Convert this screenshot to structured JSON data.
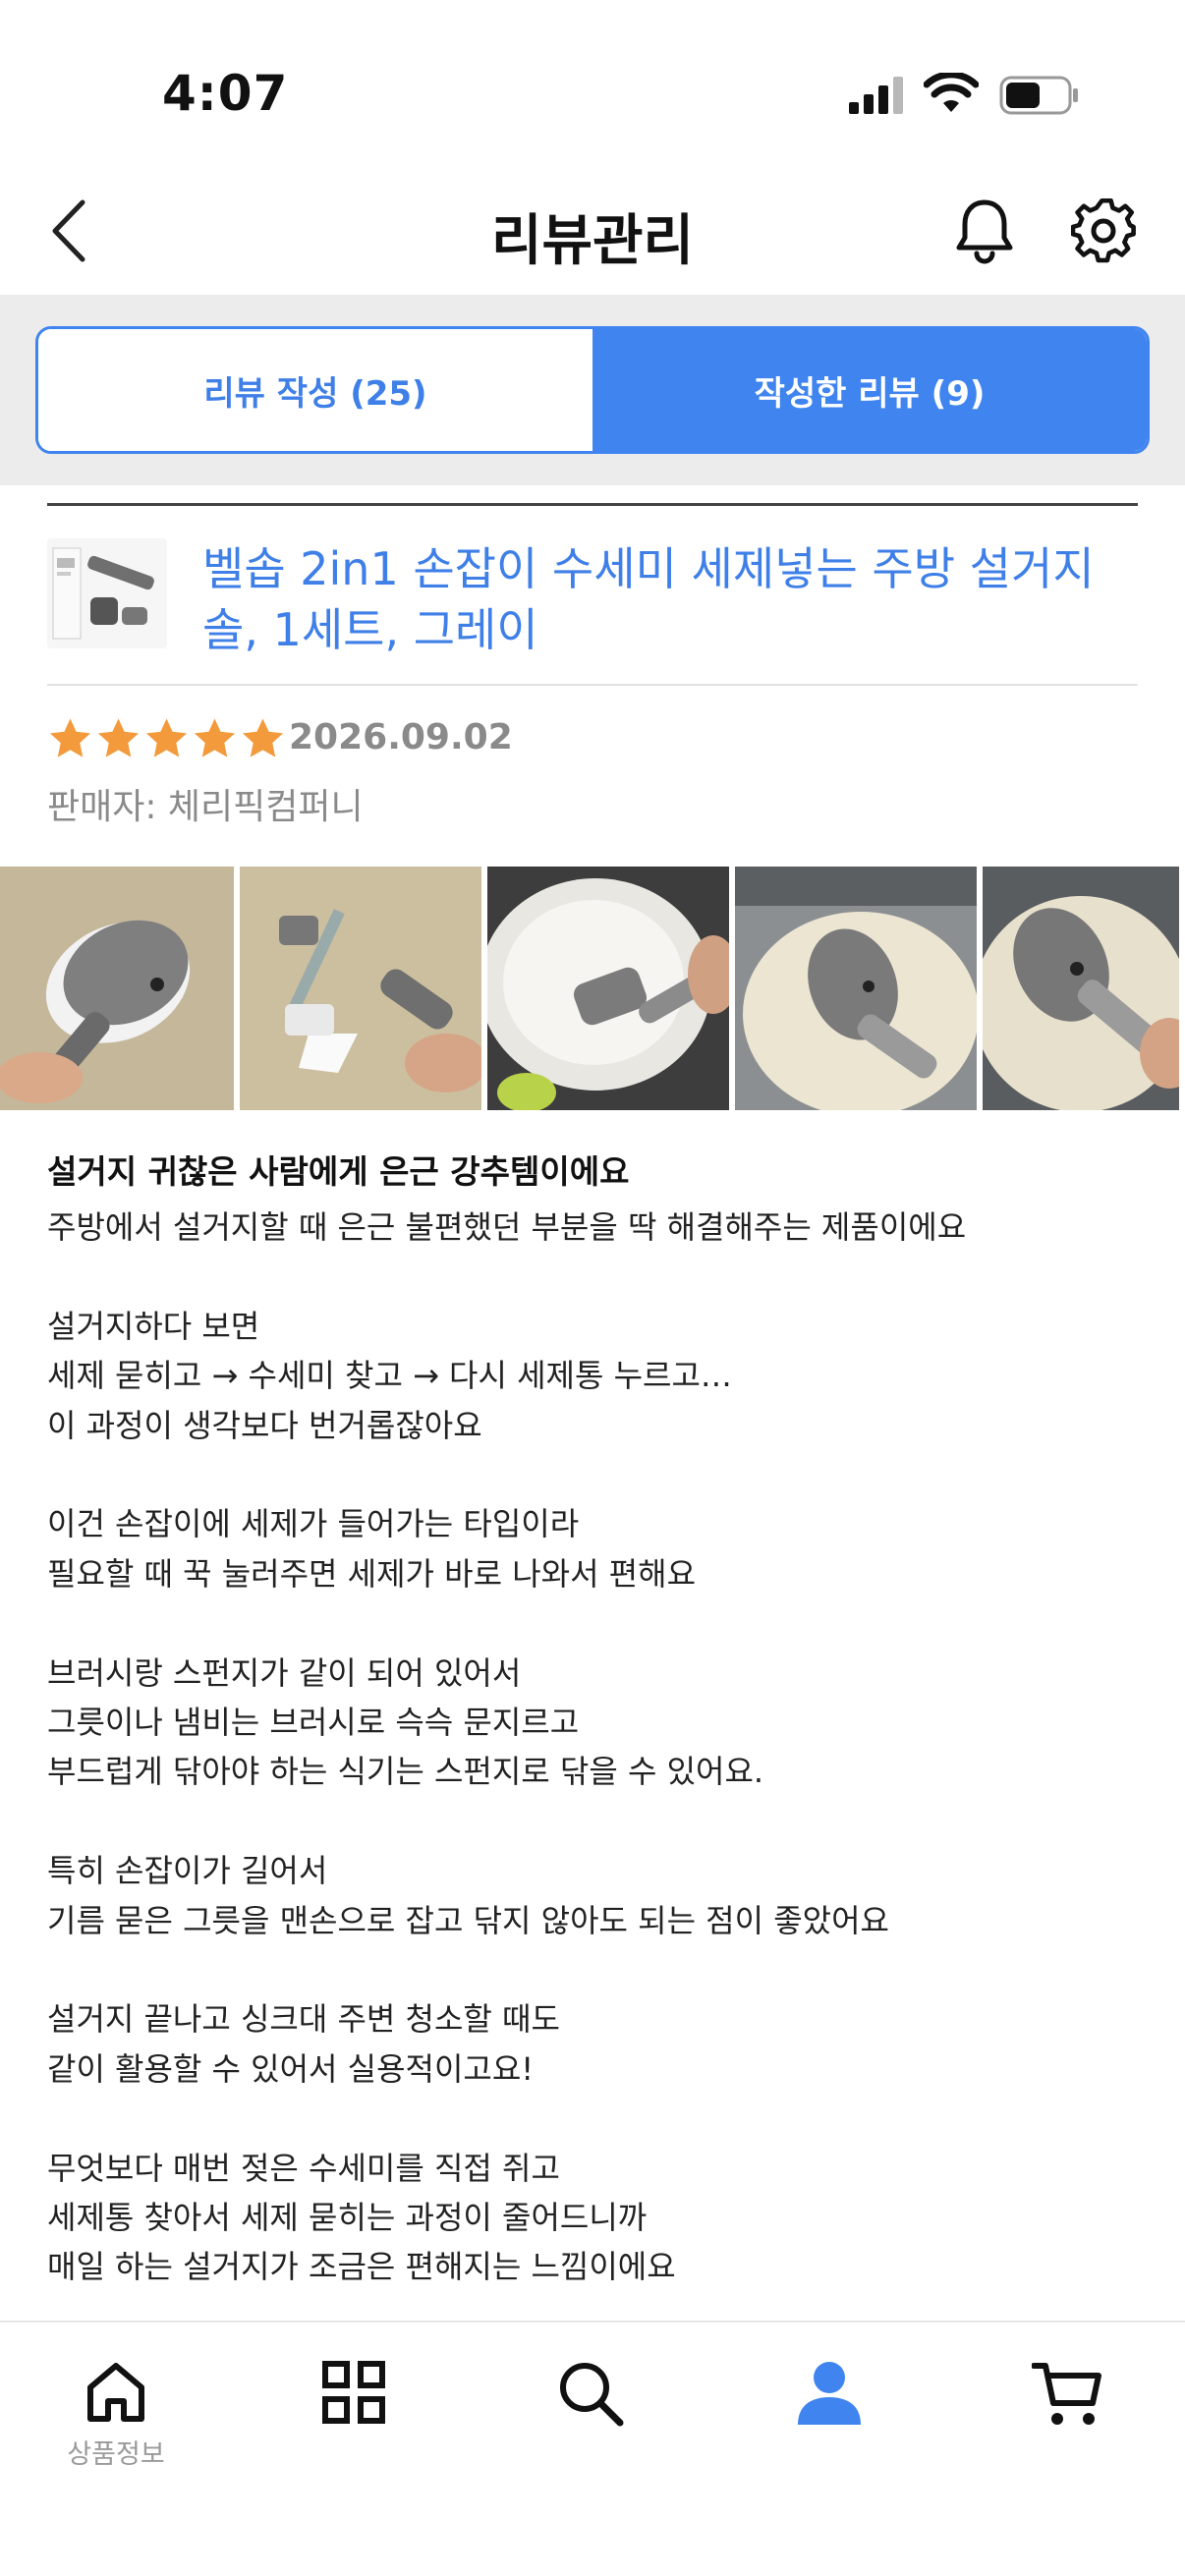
{
  "status_bar": {
    "time": "4:07"
  },
  "header": {
    "title": "리뷰관리"
  },
  "tabs": [
    {
      "label": "리뷰 작성 (25)",
      "active": false
    },
    {
      "label": "작성한 리뷰 (9)",
      "active": true
    }
  ],
  "product": {
    "name": "벨솝 2in1 손잡이 수세미 세제넣는 주방 설거지솔, 1세트, 그레이"
  },
  "review": {
    "rating": 5,
    "rating_max": 5,
    "date": "2026.09.02",
    "seller": "판매자: 체리픽컴퍼니",
    "title": "설거지 귀찮은 사람에게 은근 강추템이에요",
    "paragraphs": [
      [
        "주방에서 설거지할 때 은근 불편했던 부분을 딱 해결해주는 제품이에요"
      ],
      [
        "설거지하다 보면",
        "세제 묻히고 → 수세미 찾고 → 다시 세제통 누르고…",
        "이 과정이 생각보다 번거롭잖아요"
      ],
      [
        "이건 손잡이에 세제가 들어가는 타입이라",
        "필요할 때 꾹 눌러주면 세제가 바로 나와서 편해요"
      ],
      [
        "브러시랑 스펀지가 같이 되어 있어서",
        "그릇이나 냄비는 브러시로 슥슥 문지르고",
        "부드럽게 닦아야 하는 식기는 스펀지로 닦을 수 있어요."
      ],
      [
        "특히 손잡이가 길어서",
        "기름 묻은 그릇을 맨손으로 잡고 닦지 않아도 되는 점이 좋았어요"
      ],
      [
        "설거지 끝나고 싱크대 주변 청소할 때도",
        "같이 활용할 수 있어서 실용적이고요!"
      ],
      [
        "무엇보다 매번 젖은 수세미를 직접 쥐고",
        "세제통 찾아서 세제 묻히는 과정이 줄어드니까",
        "매일 하는 설거지가 조금은 편해지는 느낌이에요"
      ]
    ]
  },
  "bottom_nav": {
    "items": [
      {
        "icon": "home-icon",
        "label": "상품정보",
        "active": false
      },
      {
        "icon": "grid-icon",
        "label": "",
        "active": false
      },
      {
        "icon": "search-icon",
        "label": "",
        "active": false
      },
      {
        "icon": "user-icon",
        "label": "",
        "active": true
      },
      {
        "icon": "cart-icon",
        "label": "",
        "active": false
      }
    ]
  },
  "colors": {
    "accent": "#3f84ef",
    "link": "#3f7fe8",
    "star": "#f39a3c",
    "muted": "#8a8a8a",
    "tab_band": "#ececec"
  }
}
